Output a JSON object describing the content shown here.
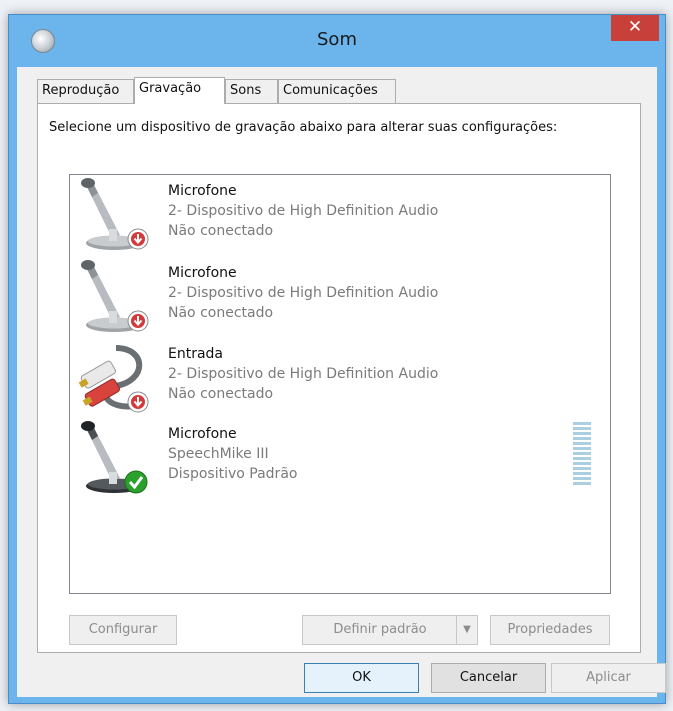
{
  "window": {
    "title": "Som",
    "close_icon": "close-icon",
    "app_icon": "speaker-icon"
  },
  "tabs": [
    {
      "label": "Reprodução",
      "active": false
    },
    {
      "label": "Gravação",
      "active": true
    },
    {
      "label": "Sons",
      "active": false
    },
    {
      "label": "Comunicações",
      "active": false
    }
  ],
  "instruction": "Selecione um dispositivo de gravação abaixo para alterar suas configurações:",
  "devices": [
    {
      "name": "Microfone",
      "description": "2- Dispositivo de High Definition Audio",
      "status": "Não conectado",
      "icon": "microphone-icon",
      "badge": "disconnected-badge-icon",
      "badge_color": "#d23b3b"
    },
    {
      "name": "Microfone",
      "description": "2- Dispositivo de High Definition Audio",
      "status": "Não conectado",
      "icon": "microphone-icon",
      "badge": "disconnected-badge-icon",
      "badge_color": "#d23b3b"
    },
    {
      "name": "Entrada",
      "description": "2- Dispositivo de High Definition Audio",
      "status": "Não conectado",
      "icon": "rca-cable-icon",
      "badge": "disconnected-badge-icon",
      "badge_color": "#d23b3b"
    },
    {
      "name": "Microfone",
      "description": "SpeechMike III",
      "status": "Dispositivo Padrão",
      "icon": "microphone-icon",
      "badge": "default-check-icon",
      "badge_color": "#2aa12a",
      "level": 0
    }
  ],
  "buttons": {
    "configure": "Configurar",
    "set_default": "Definir padrão",
    "properties": "Propriedades",
    "ok": "OK",
    "cancel": "Cancelar",
    "apply": "Aplicar"
  },
  "colors": {
    "titlebar": "#6cb4ec",
    "close": "#c7413a",
    "meter": "#a9cfe0"
  }
}
